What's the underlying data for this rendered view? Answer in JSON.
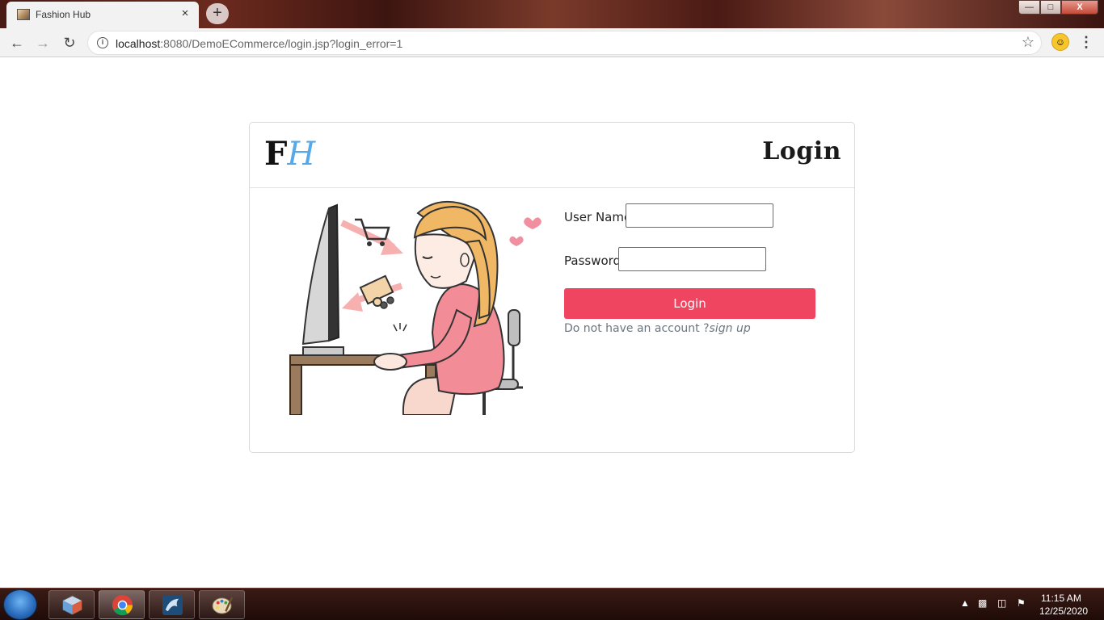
{
  "browser": {
    "tab_title": "Fashion Hub",
    "tab_close": "×",
    "new_tab": "+",
    "url_host": "localhost",
    "url_rest": ":8080/DemoECommerce/login.jsp?login_error=1",
    "window_buttons": {
      "minimize": "—",
      "maximize": "□",
      "close": "X"
    }
  },
  "card": {
    "logo_f": "F",
    "logo_h": "H",
    "title": "Login"
  },
  "form": {
    "username_label": "User Name",
    "username_value": "",
    "password_label": "Password",
    "password_value": "",
    "login_button": "Login",
    "signup_prompt": "Do not have an account ?",
    "signup_link": "sign up"
  },
  "taskbar": {
    "time": "11:15 AM",
    "date": "12/25/2020"
  },
  "colors": {
    "accent_button": "#ef4560",
    "logo_blue": "#55a9e8"
  }
}
